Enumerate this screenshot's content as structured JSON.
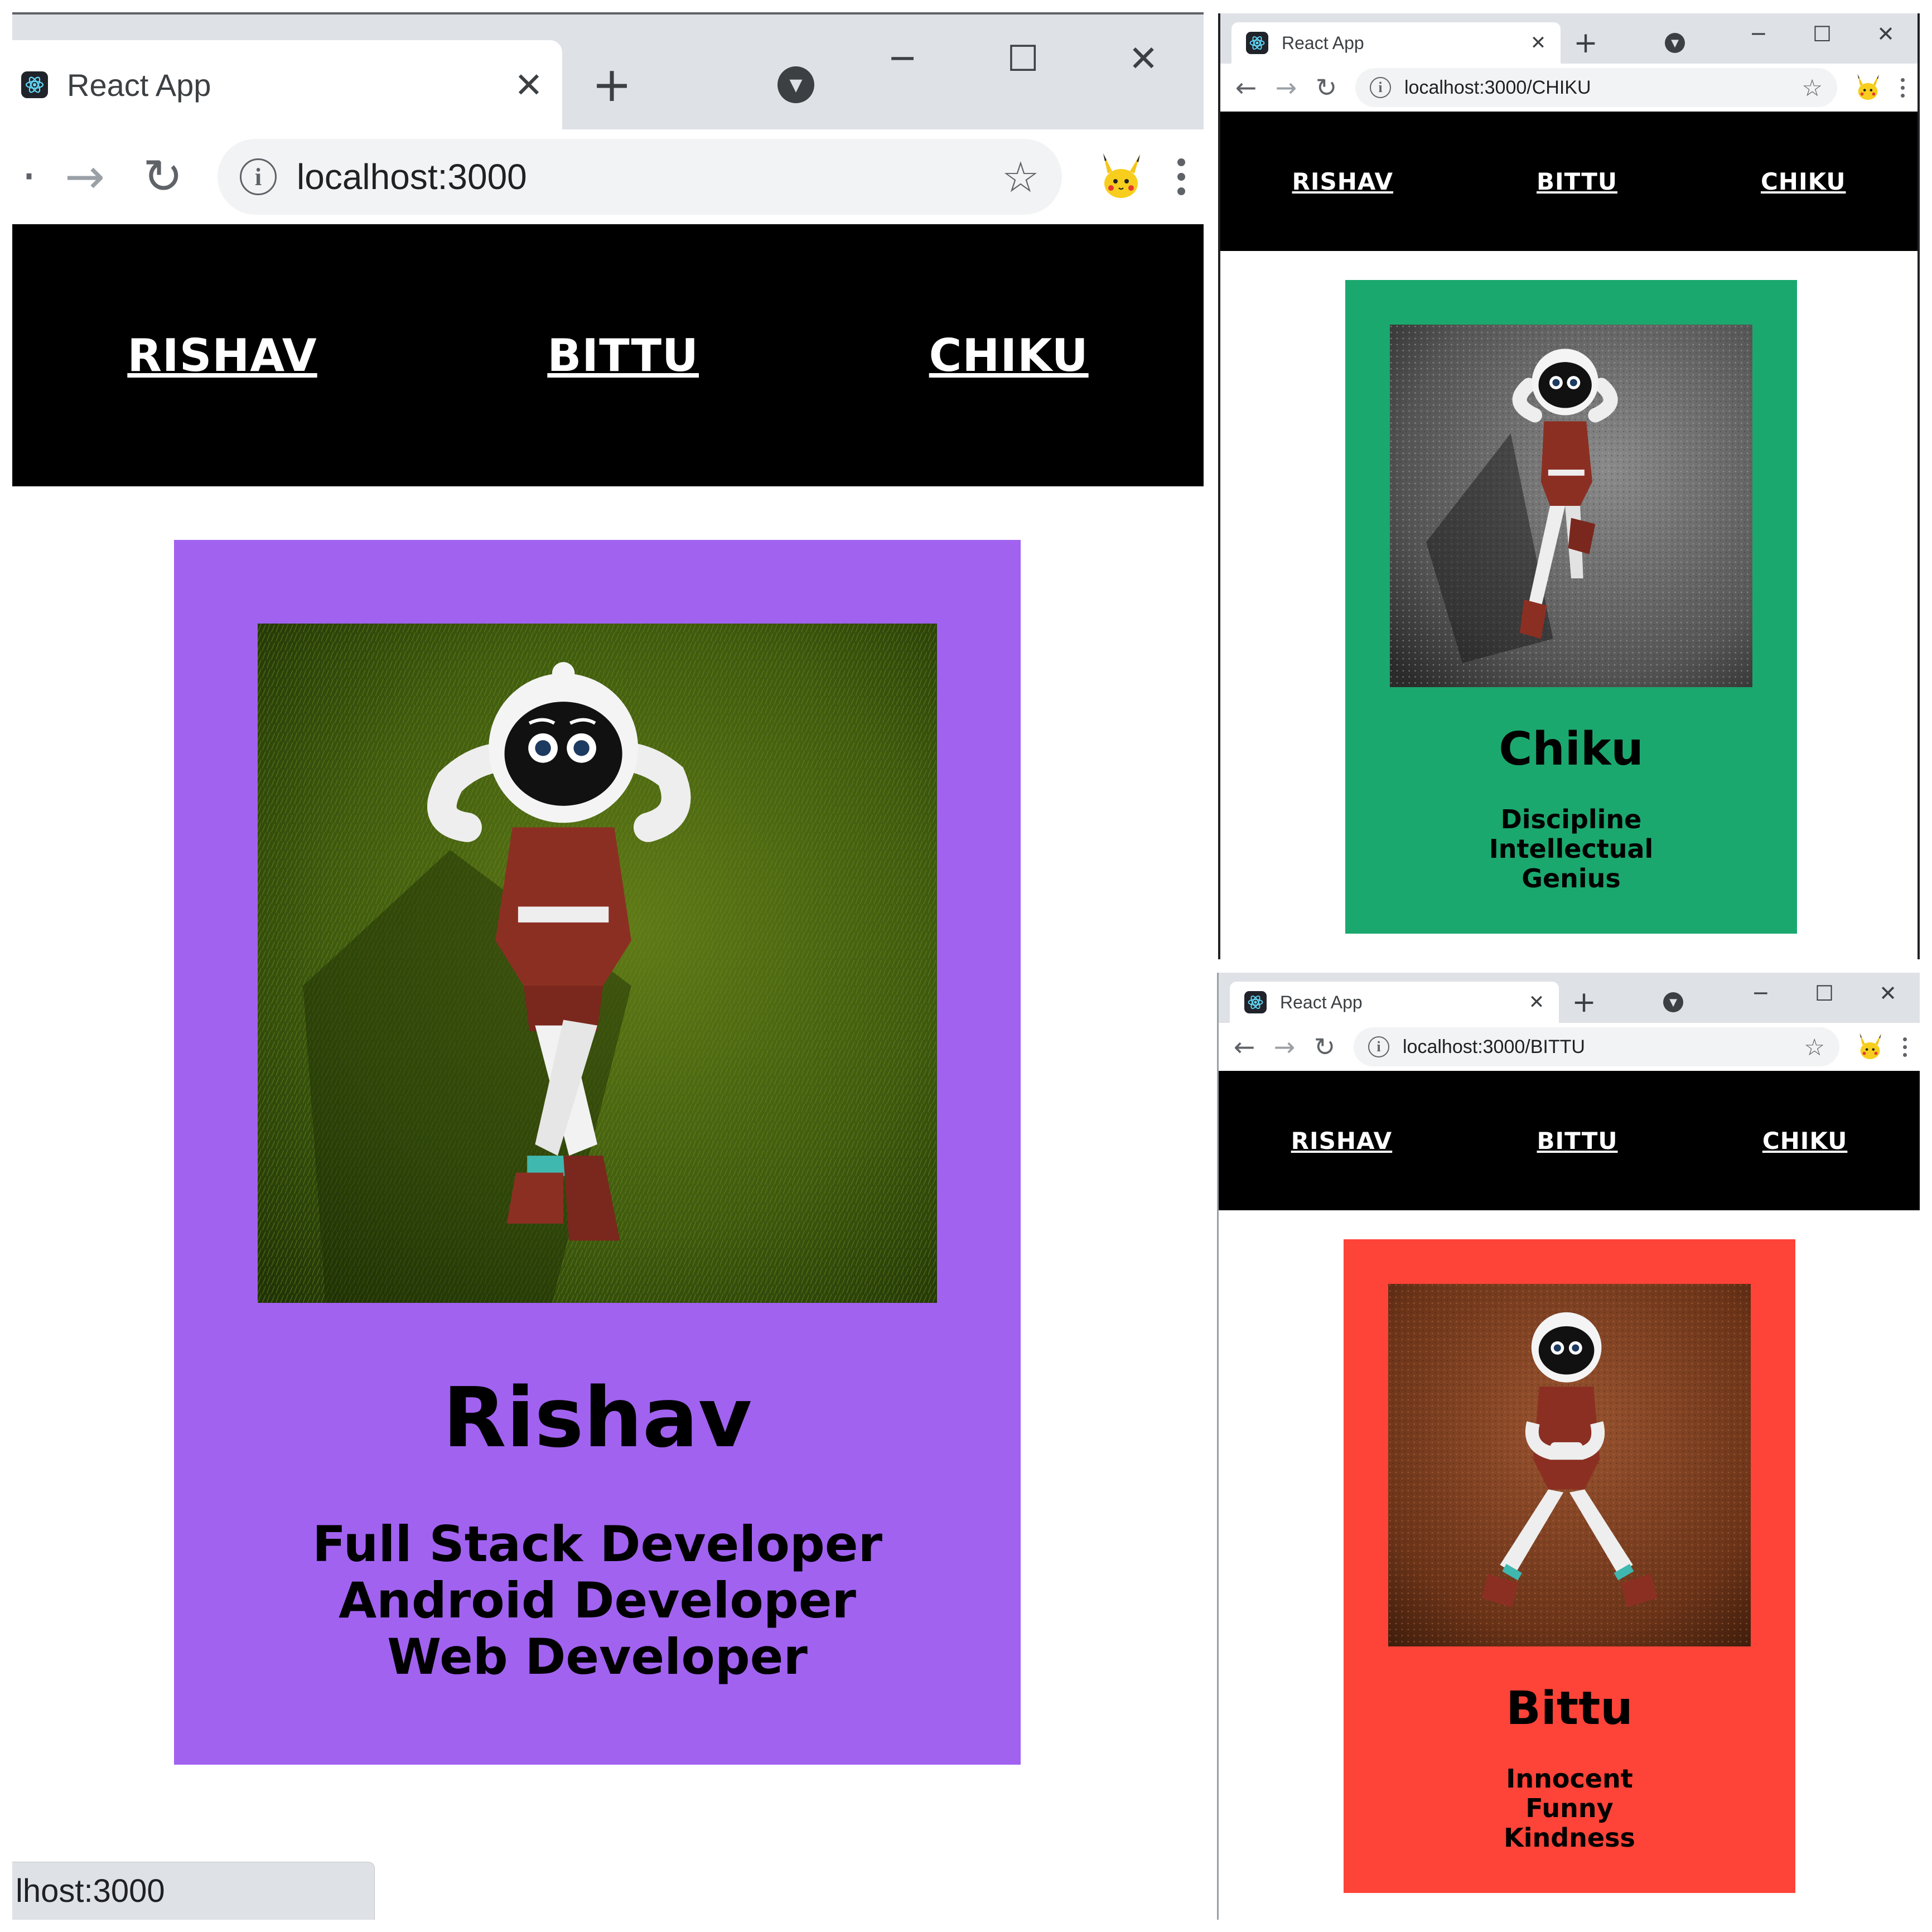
{
  "left_window": {
    "tab_title": "React App",
    "url": "localhost:3000",
    "nav": [
      "RISHAV",
      "BITTU",
      "CHIKU"
    ],
    "card": {
      "name": "Rishav",
      "traits": [
        "Full Stack Developer",
        "Android Developer",
        "Web Developer"
      ],
      "color": "#a162f0",
      "photo_surface": "grass"
    },
    "status_text": "lhost:3000"
  },
  "top_right_window": {
    "tab_title": "React App",
    "url": "localhost:3000/CHIKU",
    "nav": [
      "RISHAV",
      "BITTU",
      "CHIKU"
    ],
    "card": {
      "name": "Chiku",
      "traits": [
        "Discipline",
        "Intellectual",
        "Genius"
      ],
      "color": "#1ba86e",
      "photo_surface": "grey-gravel"
    }
  },
  "bottom_right_window": {
    "tab_title": "React App",
    "url": "localhost:3000/BITTU",
    "nav": [
      "RISHAV",
      "BITTU",
      "CHIKU"
    ],
    "card": {
      "name": "Bittu",
      "traits": [
        "Innocent",
        "Funny",
        "Kindness"
      ],
      "color": "#fe4338",
      "photo_surface": "red-soil"
    }
  },
  "icons": {
    "favicon": "react-logo-icon",
    "back": "arrow-left-icon",
    "forward": "arrow-right-icon",
    "reload": "reload-icon",
    "info": "info-icon",
    "bookmark": "star-icon",
    "extension": "pikachu-extension-icon",
    "menu": "three-dots-icon"
  }
}
